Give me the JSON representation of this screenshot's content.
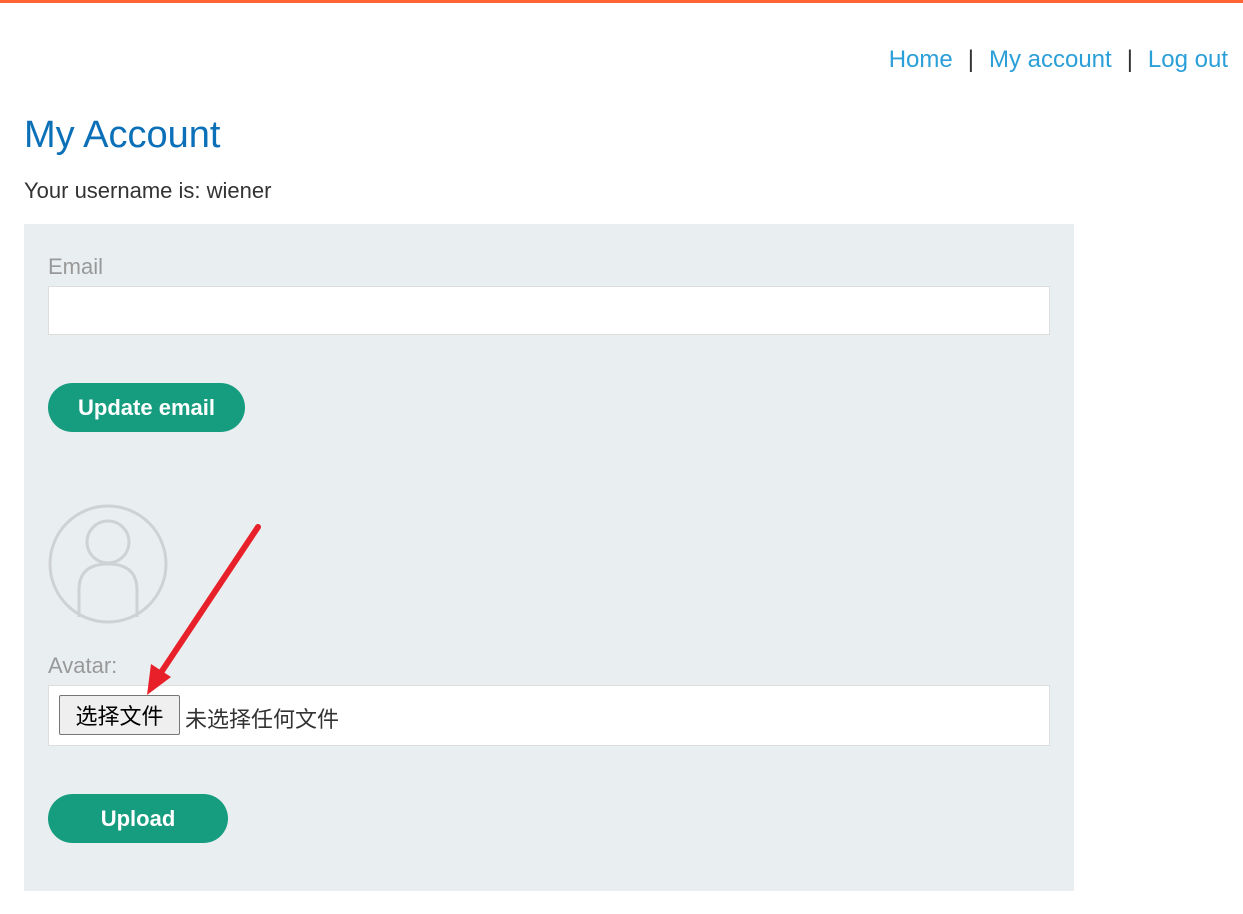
{
  "nav": {
    "home": "Home",
    "separator": "|",
    "my_account": "My account",
    "log_out": "Log out"
  },
  "page": {
    "title": "My Account",
    "username_line": "Your username is: wiener"
  },
  "form": {
    "email_label": "Email",
    "email_value": "",
    "update_button": "Update email",
    "avatar_label": "Avatar:",
    "choose_file_button": "选择文件",
    "file_status": "未选择任何文件",
    "upload_button": "Upload"
  },
  "colors": {
    "accent_bar": "#ff6633",
    "link": "#2a9fd8",
    "title": "#0b70b8",
    "button": "#169d80",
    "panel": "#e9eef1",
    "annotation_arrow": "#e8202a"
  },
  "icons": {
    "avatar": "user-placeholder-icon",
    "annotation": "red-arrow-annotation"
  }
}
